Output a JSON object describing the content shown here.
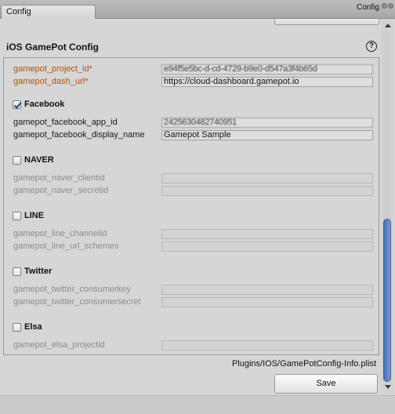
{
  "window": {
    "tab_label": "Config",
    "title": "Config"
  },
  "section": {
    "title": "iOS GamePot Config",
    "help_icon": "question-circle-icon"
  },
  "required": [
    {
      "label": "gamepot_project_id*",
      "value": "e94f5e5bc-d-cd-4729-b9e0-d547a3f4b65d"
    },
    {
      "label": "gamepot_dash_url*",
      "value": "https://cloud-dashboard.gamepot.io"
    }
  ],
  "facebook": {
    "label": "Facebook",
    "checked": true,
    "fields": [
      {
        "label": "gamepot_facebook_app_id",
        "value": "2425630482740951"
      },
      {
        "label": "gamepot_facebook_display_name",
        "value": "Gamepot Sample"
      }
    ]
  },
  "naver": {
    "label": "NAVER",
    "checked": false,
    "fields": [
      {
        "label": "gamepot_naver_clientid",
        "value": ""
      },
      {
        "label": "gamepot_naver_secretid",
        "value": ""
      }
    ]
  },
  "line": {
    "label": "LINE",
    "checked": false,
    "fields": [
      {
        "label": "gamepot_line_channelid",
        "value": ""
      },
      {
        "label": "gamepot_line_url_schemes",
        "value": ""
      }
    ]
  },
  "twitter": {
    "label": "Twitter",
    "checked": false,
    "fields": [
      {
        "label": "gamepot_twitter_consumerkey",
        "value": ""
      },
      {
        "label": "gamepot_twitter_consumersecret",
        "value": ""
      }
    ]
  },
  "elsa": {
    "label": "Elsa",
    "checked": false,
    "fields": [
      {
        "label": "gamepot_elsa_projectid",
        "value": ""
      }
    ]
  },
  "footer": {
    "path": "Plugins/IOS/GamePotConfig-Info.plist",
    "save_label": "Save"
  },
  "colors": {
    "required_label": "#b2540d",
    "disabled_label": "#8d8d8d",
    "scroll_thumb": "#5a7dbd"
  }
}
